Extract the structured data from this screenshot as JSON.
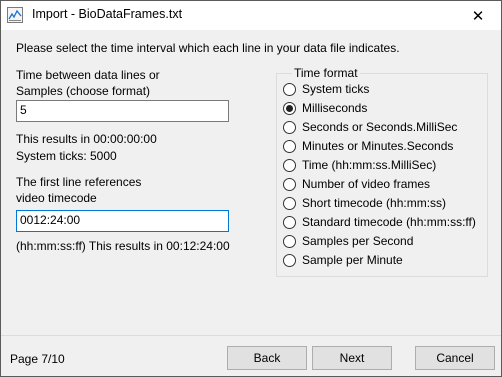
{
  "window": {
    "title": "Import - BioDataFrames.txt"
  },
  "instruction": "Please select the time interval which each line in your data file indicates.",
  "interval": {
    "label_line1": "Time between data lines or",
    "label_line2": "Samples (choose format)",
    "value": "5",
    "result_line1": "This results in 00:00:00:00",
    "result_line2": "System ticks: 5000"
  },
  "timecode": {
    "label_line1": "The first line references",
    "label_line2": "video timecode",
    "value": "0012:24:00",
    "note": "(hh:mm:ss:ff) This results in 00:12:24:00"
  },
  "time_format": {
    "title": "Time format",
    "selected": "Milliseconds",
    "options": [
      "System ticks",
      "Milliseconds",
      "Seconds or Seconds.MilliSec",
      "Minutes or Minutes.Seconds",
      "Time (hh:mm:ss.MilliSec)",
      "Number of video frames",
      "Short timecode (hh:mm:ss)",
      "Standard timecode (hh:mm:ss:ff)",
      "Samples per Second",
      "Sample per Minute"
    ]
  },
  "footer": {
    "page_label": "Page  7/10",
    "back_label": "Back",
    "next_label": "Next",
    "cancel_label": "Cancel"
  },
  "icons": {
    "close": "close-icon",
    "app": "app-icon"
  }
}
